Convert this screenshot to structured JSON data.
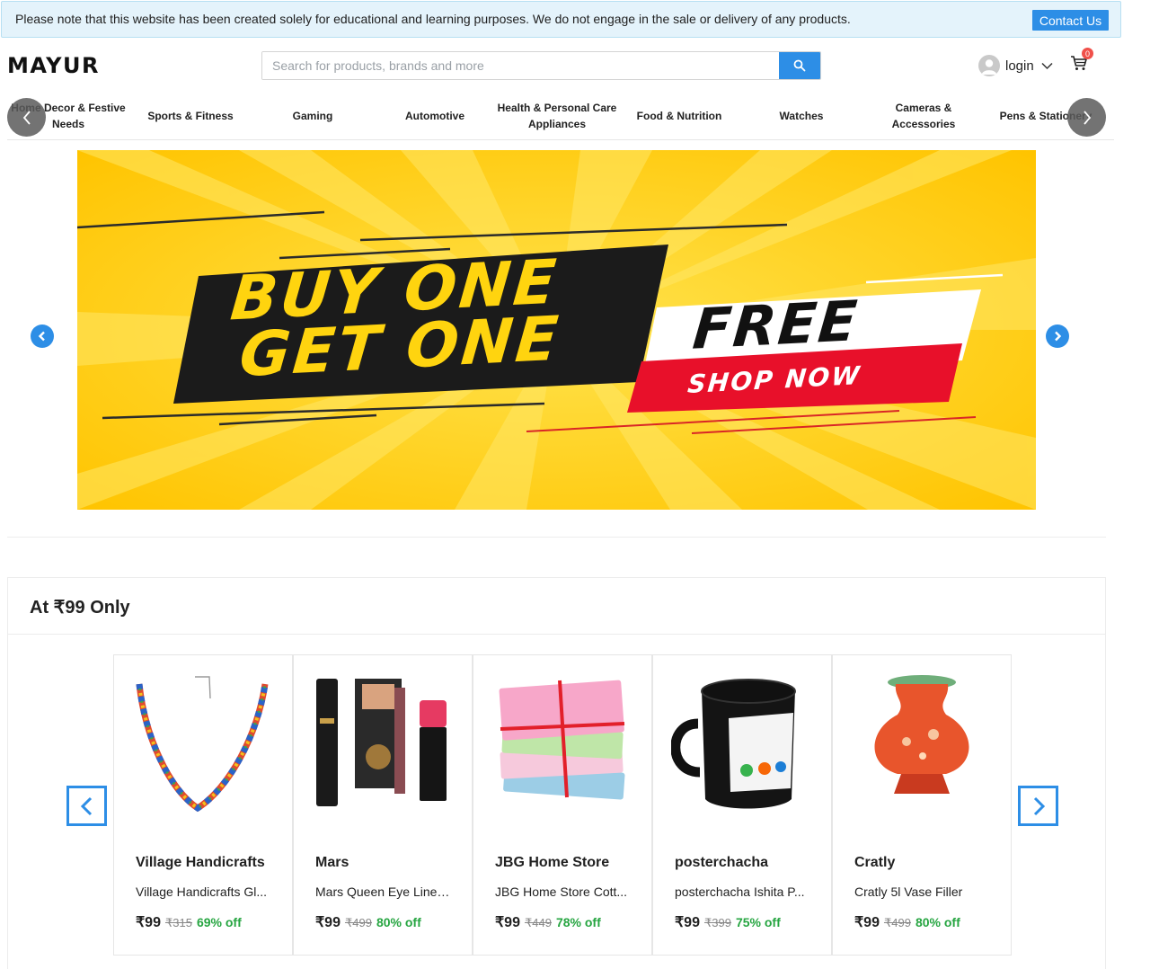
{
  "notice": {
    "text": "Please note that this website has been created solely for educational and learning purposes. We do not engage in the sale or delivery of any products.",
    "contact_label": "Contact Us"
  },
  "header": {
    "logo": "MAYUR",
    "search_placeholder": "Search for products, brands and more",
    "login_label": "login",
    "cart_count": "0"
  },
  "categories": [
    "Home Decor & Festive Needs",
    "Sports & Fitness",
    "Gaming",
    "Automotive",
    "Health & Personal Care Appliances",
    "Food & Nutrition",
    "Watches",
    "Cameras & Accessories",
    "Pens & Stationery"
  ],
  "banner": {
    "line1": "BUY ONE",
    "line2": "GET ONE",
    "free": "FREE",
    "shop": "SHOP NOW"
  },
  "deals": {
    "title": "At ₹99 Only",
    "products": [
      {
        "brand": "Village Handicrafts",
        "name": "Village Handicrafts Gl...",
        "price": "₹99",
        "mrp": "₹315",
        "off": "69% off"
      },
      {
        "brand": "Mars",
        "name": "Mars Queen Eye Liner, ...",
        "price": "₹99",
        "mrp": "₹499",
        "off": "80% off"
      },
      {
        "brand": "JBG Home Store",
        "name": "JBG Home Store Cott...",
        "price": "₹99",
        "mrp": "₹449",
        "off": "78% off"
      },
      {
        "brand": "posterchacha",
        "name": "posterchacha Ishita P...",
        "price": "₹99",
        "mrp": "₹399",
        "off": "75% off"
      },
      {
        "brand": "Cratly",
        "name": "Cratly 5l Vase Filler",
        "price": "₹99",
        "mrp": "₹499",
        "off": "80% off"
      }
    ]
  },
  "colors": {
    "accent": "#2d8ee6",
    "notice_bg": "#e4f3fb",
    "discount": "#26a541",
    "badge": "#f0504a",
    "banner_yellow": "#ffd40f"
  },
  "icons": [
    "search-icon",
    "user-icon",
    "chevron-down-icon",
    "cart-icon",
    "chevron-left-icon",
    "chevron-right-icon"
  ]
}
